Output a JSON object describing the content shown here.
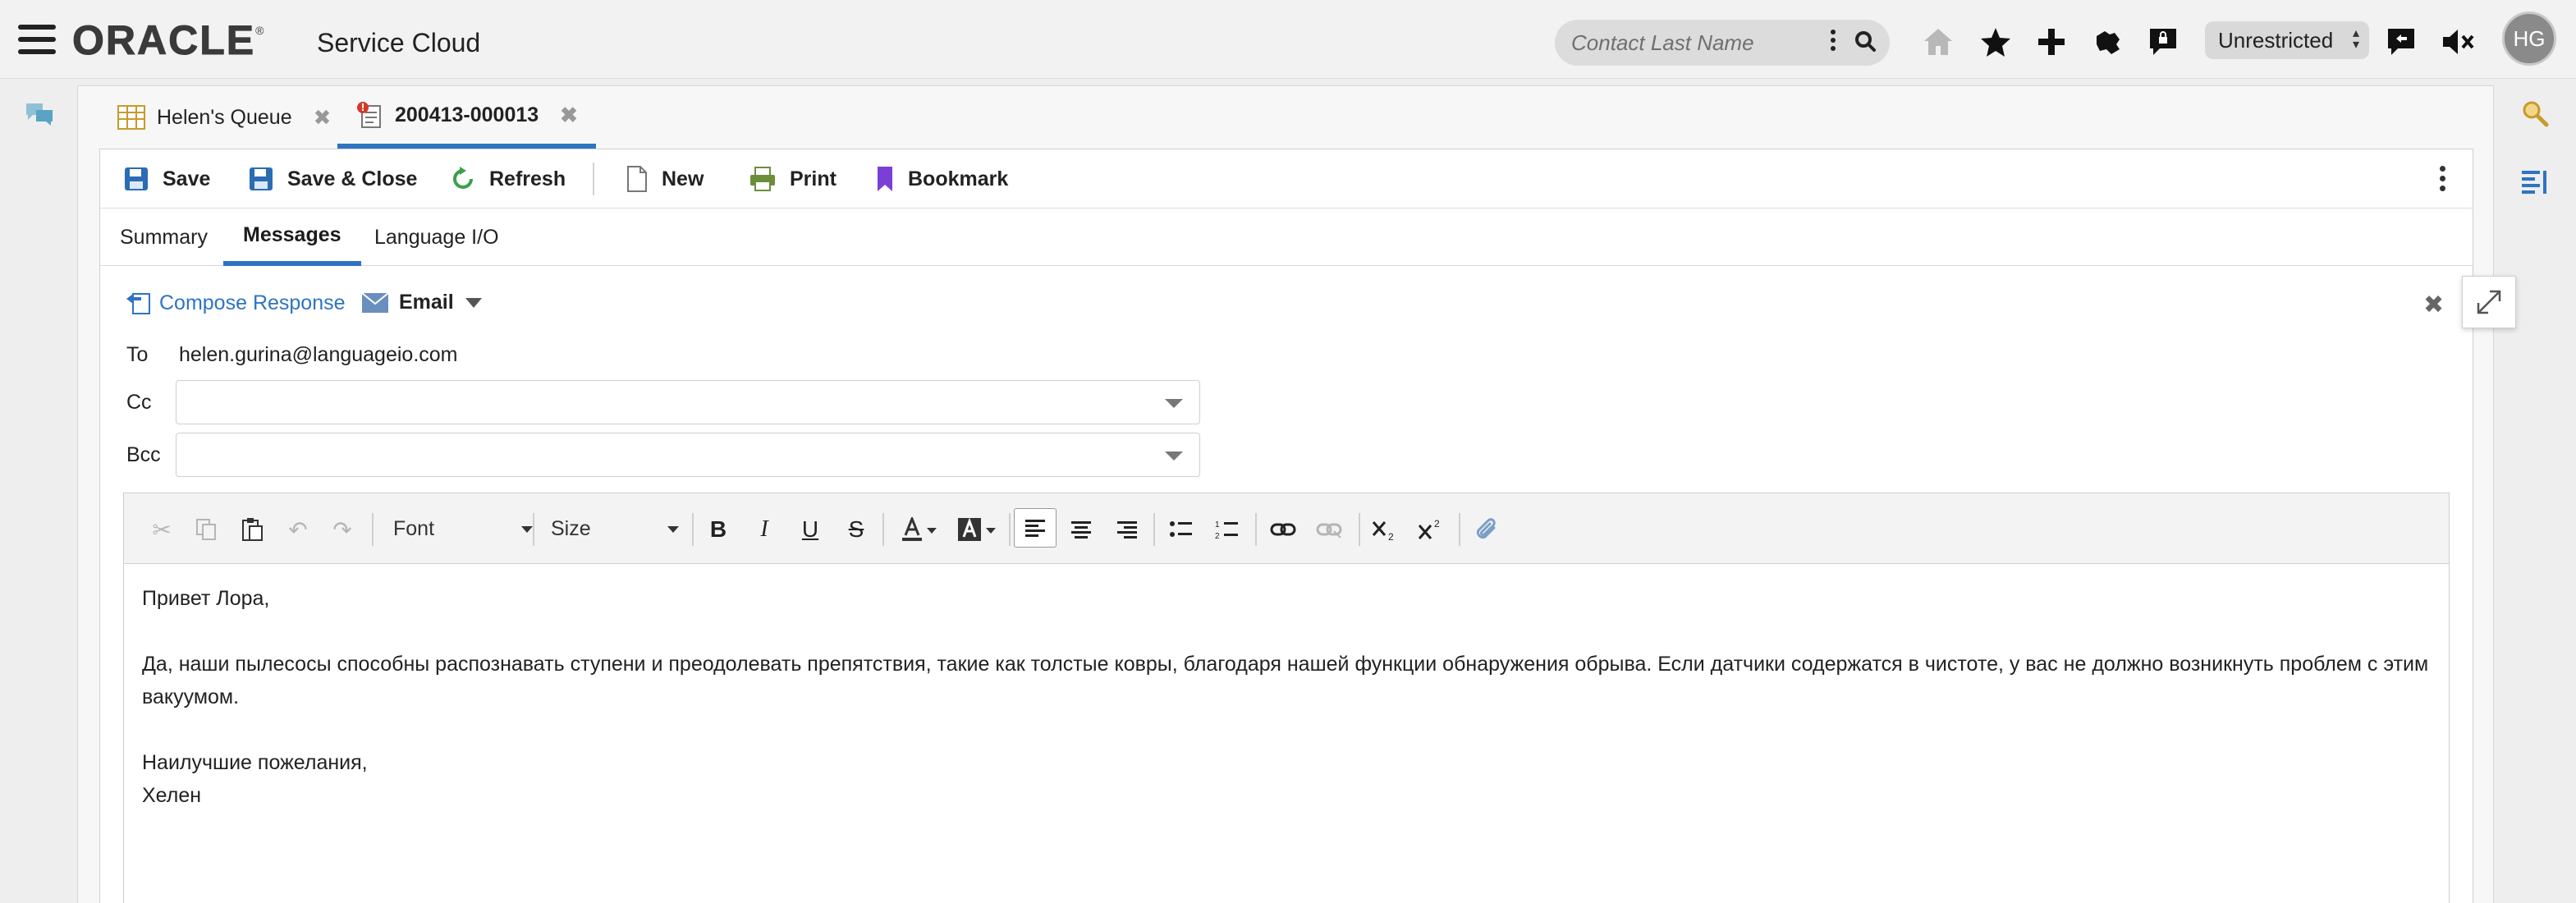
{
  "header": {
    "logo_text": "ORACLE",
    "product_name": "Service Cloud",
    "search_placeholder": "Contact Last Name",
    "scope_value": "Unrestricted",
    "avatar_initials": "HG",
    "icons": [
      "home-icon",
      "star-icon",
      "plus-icon",
      "puzzle-icon",
      "lock-chat-icon",
      "chat-icon",
      "mute-icon"
    ]
  },
  "workspace_tabs": [
    {
      "label": "Helen's Queue",
      "icon": "table-icon",
      "active": false
    },
    {
      "label": "200413-000013",
      "icon": "incident-icon",
      "active": true
    }
  ],
  "toolbar": {
    "save": "Save",
    "save_close": "Save & Close",
    "refresh": "Refresh",
    "new": "New",
    "print": "Print",
    "bookmark": "Bookmark"
  },
  "subtabs": [
    {
      "label": "Summary",
      "active": false
    },
    {
      "label": "Messages",
      "active": true
    },
    {
      "label": "Language I/O",
      "active": false
    }
  ],
  "compose": {
    "compose_response": "Compose Response",
    "channel": "Email",
    "to_label": "To",
    "to_value": "helen.gurina@languageio.com",
    "cc_label": "Cc",
    "cc_value": "",
    "bcc_label": "Bcc",
    "bcc_value": ""
  },
  "editor": {
    "font_label": "Font",
    "size_label": "Size",
    "body": {
      "greeting": "Привет Лора,",
      "paragraph": "Да, наши пылесосы способны распознавать ступени и преодолевать препятствия, такие как толстые ковры, благодаря нашей функции обнаружения обрыва. Если датчики содержатся в чистоте, у вас не должно возникнуть проблем с этим вакуумом.",
      "closing": "Наилучшие пожелания,",
      "signature": "Хелен"
    }
  },
  "colors": {
    "accent": "#2e74c2",
    "bookmark": "#7a3fd6",
    "refresh": "#3aa14a",
    "print": "#6b8e3a",
    "save": "#2b6cb3"
  }
}
